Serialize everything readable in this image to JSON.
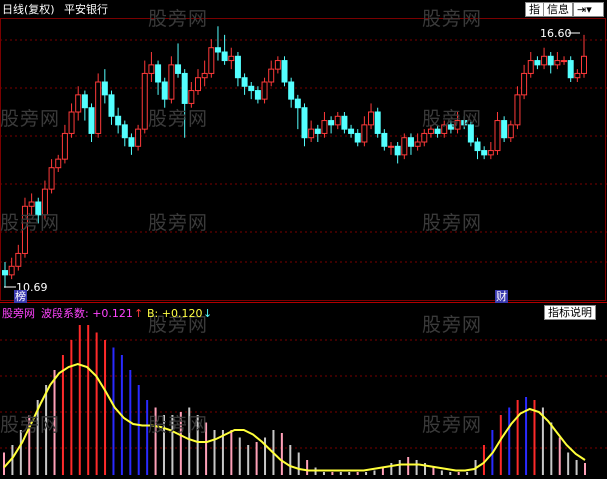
{
  "header": {
    "title": "日线(复权)",
    "stock_name": "平安银行",
    "btn_indicator": "指",
    "btn_info": "信息",
    "btn_arrows": "⇥▾"
  },
  "watermark": "股旁网",
  "price_panel": {
    "high_label": "16.60",
    "low_label": "10.69",
    "marker_bang": "榜",
    "marker_cai": "财"
  },
  "indicator_panel": {
    "name": "股旁网",
    "coef_label": "波段系数: +0.121",
    "b_label": "B: +0.120",
    "help_button": "指标说明",
    "arrow_up": "↑",
    "arrow_down": "↓"
  },
  "colors": {
    "up": "#ff3a3a",
    "down": "#54ffff",
    "grid": "#7a0000",
    "yellow_line": "#ffff3a",
    "bar_red": "#ff2a2a",
    "bar_blue": "#2a2aff",
    "bar_pink": "#ffa0b8",
    "bar_gray": "#c8c8c8",
    "coef_color": "#ff44ff",
    "b_color": "#ffff44"
  },
  "chart_data": {
    "candles": [
      [
        11.1,
        11.0,
        11.3,
        10.7
      ],
      [
        11.0,
        11.2,
        11.4,
        10.9
      ],
      [
        11.2,
        11.5,
        11.7,
        11.1
      ],
      [
        11.5,
        12.6,
        12.8,
        11.4
      ],
      [
        12.6,
        12.7,
        12.9,
        12.4
      ],
      [
        12.7,
        12.4,
        12.8,
        12.2
      ],
      [
        12.4,
        13.0,
        13.2,
        12.3
      ],
      [
        13.0,
        13.5,
        13.7,
        12.9
      ],
      [
        13.5,
        13.7,
        13.8,
        13.4
      ],
      [
        13.7,
        14.3,
        14.5,
        13.6
      ],
      [
        14.3,
        14.8,
        15.0,
        14.2
      ],
      [
        14.8,
        15.2,
        15.4,
        14.6
      ],
      [
        15.2,
        14.9,
        15.3,
        14.6
      ],
      [
        14.9,
        14.3,
        15.0,
        14.1
      ],
      [
        14.3,
        15.5,
        15.7,
        14.2
      ],
      [
        15.5,
        15.2,
        15.8,
        15.0
      ],
      [
        15.2,
        14.7,
        15.3,
        14.5
      ],
      [
        14.7,
        14.5,
        14.9,
        14.3
      ],
      [
        14.5,
        14.2,
        14.6,
        14.0
      ],
      [
        14.2,
        14.0,
        14.3,
        13.8
      ],
      [
        14.0,
        14.4,
        14.5,
        13.9
      ],
      [
        14.4,
        15.7,
        16.0,
        14.3
      ],
      [
        15.7,
        15.9,
        16.2,
        15.5
      ],
      [
        15.9,
        15.5,
        16.0,
        15.2
      ],
      [
        15.5,
        15.1,
        15.6,
        14.9
      ],
      [
        15.1,
        15.9,
        16.1,
        15.0
      ],
      [
        15.9,
        15.7,
        16.4,
        15.6
      ],
      [
        15.7,
        15.0,
        15.8,
        14.2
      ],
      [
        15.0,
        15.3,
        15.5,
        14.9
      ],
      [
        15.3,
        15.6,
        15.8,
        15.2
      ],
      [
        15.6,
        15.7,
        16.0,
        15.4
      ],
      [
        15.7,
        16.3,
        16.5,
        15.6
      ],
      [
        16.3,
        16.2,
        16.8,
        16.0
      ],
      [
        16.2,
        16.0,
        16.6,
        15.9
      ],
      [
        16.0,
        16.1,
        16.3,
        15.8
      ],
      [
        16.1,
        15.6,
        16.2,
        15.4
      ],
      [
        15.6,
        15.4,
        15.7,
        15.2
      ],
      [
        15.4,
        15.3,
        15.5,
        15.1
      ],
      [
        15.3,
        15.1,
        15.4,
        15.0
      ],
      [
        15.1,
        15.5,
        15.6,
        15.0
      ],
      [
        15.5,
        15.8,
        16.0,
        15.4
      ],
      [
        15.8,
        16.0,
        16.1,
        15.7
      ],
      [
        16.0,
        15.5,
        16.1,
        15.4
      ],
      [
        15.5,
        15.1,
        15.6,
        14.9
      ],
      [
        15.1,
        14.9,
        15.2,
        14.4
      ],
      [
        14.9,
        14.2,
        15.0,
        14.0
      ],
      [
        14.2,
        14.4,
        14.6,
        14.1
      ],
      [
        14.4,
        14.3,
        14.5,
        14.1
      ],
      [
        14.3,
        14.6,
        14.8,
        14.2
      ],
      [
        14.6,
        14.5,
        14.7,
        14.3
      ],
      [
        14.5,
        14.7,
        14.8,
        14.4
      ],
      [
        14.7,
        14.4,
        14.8,
        14.3
      ],
      [
        14.4,
        14.3,
        14.5,
        14.2
      ],
      [
        14.3,
        14.1,
        14.4,
        14.0
      ],
      [
        14.1,
        14.5,
        14.7,
        14.0
      ],
      [
        14.5,
        14.8,
        15.0,
        14.4
      ],
      [
        14.8,
        14.3,
        14.9,
        14.2
      ],
      [
        14.3,
        14.0,
        14.4,
        13.9
      ],
      [
        14.0,
        14.0,
        14.1,
        13.8
      ],
      [
        14.0,
        13.8,
        14.1,
        13.6
      ],
      [
        13.8,
        14.2,
        14.3,
        13.7
      ],
      [
        14.2,
        14.0,
        14.3,
        13.8
      ],
      [
        14.0,
        14.1,
        14.3,
        13.9
      ],
      [
        14.1,
        14.3,
        14.4,
        14.0
      ],
      [
        14.3,
        14.4,
        14.5,
        14.2
      ],
      [
        14.4,
        14.3,
        14.5,
        14.2
      ],
      [
        14.3,
        14.5,
        14.6,
        14.2
      ],
      [
        14.5,
        14.4,
        14.6,
        14.3
      ],
      [
        14.4,
        14.6,
        14.8,
        14.3
      ],
      [
        14.6,
        14.5,
        14.7,
        14.4
      ],
      [
        14.5,
        14.1,
        14.6,
        14.0
      ],
      [
        14.1,
        13.9,
        14.2,
        13.7
      ],
      [
        13.9,
        13.8,
        14.0,
        13.7
      ],
      [
        13.8,
        13.9,
        14.1,
        13.7
      ],
      [
        13.9,
        14.6,
        14.8,
        13.8
      ],
      [
        14.6,
        14.2,
        14.7,
        14.1
      ],
      [
        14.2,
        14.5,
        14.6,
        14.1
      ],
      [
        14.5,
        15.2,
        15.4,
        14.4
      ],
      [
        15.2,
        15.7,
        15.9,
        15.1
      ],
      [
        15.7,
        16.0,
        16.2,
        15.6
      ],
      [
        16.0,
        15.9,
        16.1,
        15.8
      ],
      [
        15.9,
        16.1,
        16.3,
        15.8
      ],
      [
        16.1,
        15.9,
        16.2,
        15.7
      ],
      [
        15.9,
        16.0,
        16.2,
        15.8
      ],
      [
        16.0,
        16.0,
        16.1,
        15.9
      ],
      [
        16.0,
        15.6,
        16.1,
        15.5
      ],
      [
        15.6,
        15.7,
        15.8,
        15.5
      ],
      [
        15.7,
        16.1,
        16.6,
        15.6
      ]
    ],
    "indicator_bars": [
      0.15,
      0.2,
      0.3,
      0.4,
      0.5,
      0.6,
      0.7,
      0.8,
      0.9,
      1.0,
      1.0,
      0.95,
      0.9,
      0.85,
      0.8,
      0.7,
      0.6,
      0.5,
      0.45,
      0.4,
      0.4,
      0.42,
      0.45,
      0.4,
      0.35,
      0.3,
      0.3,
      0.3,
      0.25,
      0.2,
      0.22,
      0.25,
      0.3,
      0.28,
      0.2,
      0.15,
      0.1,
      0.05,
      0.02,
      0.02,
      0.02,
      0.02,
      0.02,
      0.02,
      0.03,
      0.05,
      0.08,
      0.1,
      0.12,
      0.1,
      0.08,
      0.05,
      0.03,
      0.02,
      0.02,
      0.02,
      0.1,
      0.2,
      0.3,
      0.4,
      0.45,
      0.5,
      0.52,
      0.5,
      0.45,
      0.35,
      0.25,
      0.15,
      0.1,
      0.08
    ],
    "indicator_line": [
      0.05,
      0.12,
      0.22,
      0.35,
      0.48,
      0.6,
      0.68,
      0.72,
      0.74,
      0.72,
      0.66,
      0.56,
      0.45,
      0.38,
      0.34,
      0.33,
      0.33,
      0.32,
      0.3,
      0.27,
      0.24,
      0.22,
      0.22,
      0.24,
      0.27,
      0.3,
      0.3,
      0.27,
      0.22,
      0.16,
      0.1,
      0.06,
      0.04,
      0.03,
      0.03,
      0.03,
      0.03,
      0.03,
      0.03,
      0.03,
      0.04,
      0.05,
      0.06,
      0.07,
      0.07,
      0.07,
      0.06,
      0.05,
      0.04,
      0.03,
      0.03,
      0.04,
      0.08,
      0.15,
      0.25,
      0.34,
      0.41,
      0.44,
      0.42,
      0.36,
      0.28,
      0.2,
      0.14,
      0.1
    ]
  }
}
